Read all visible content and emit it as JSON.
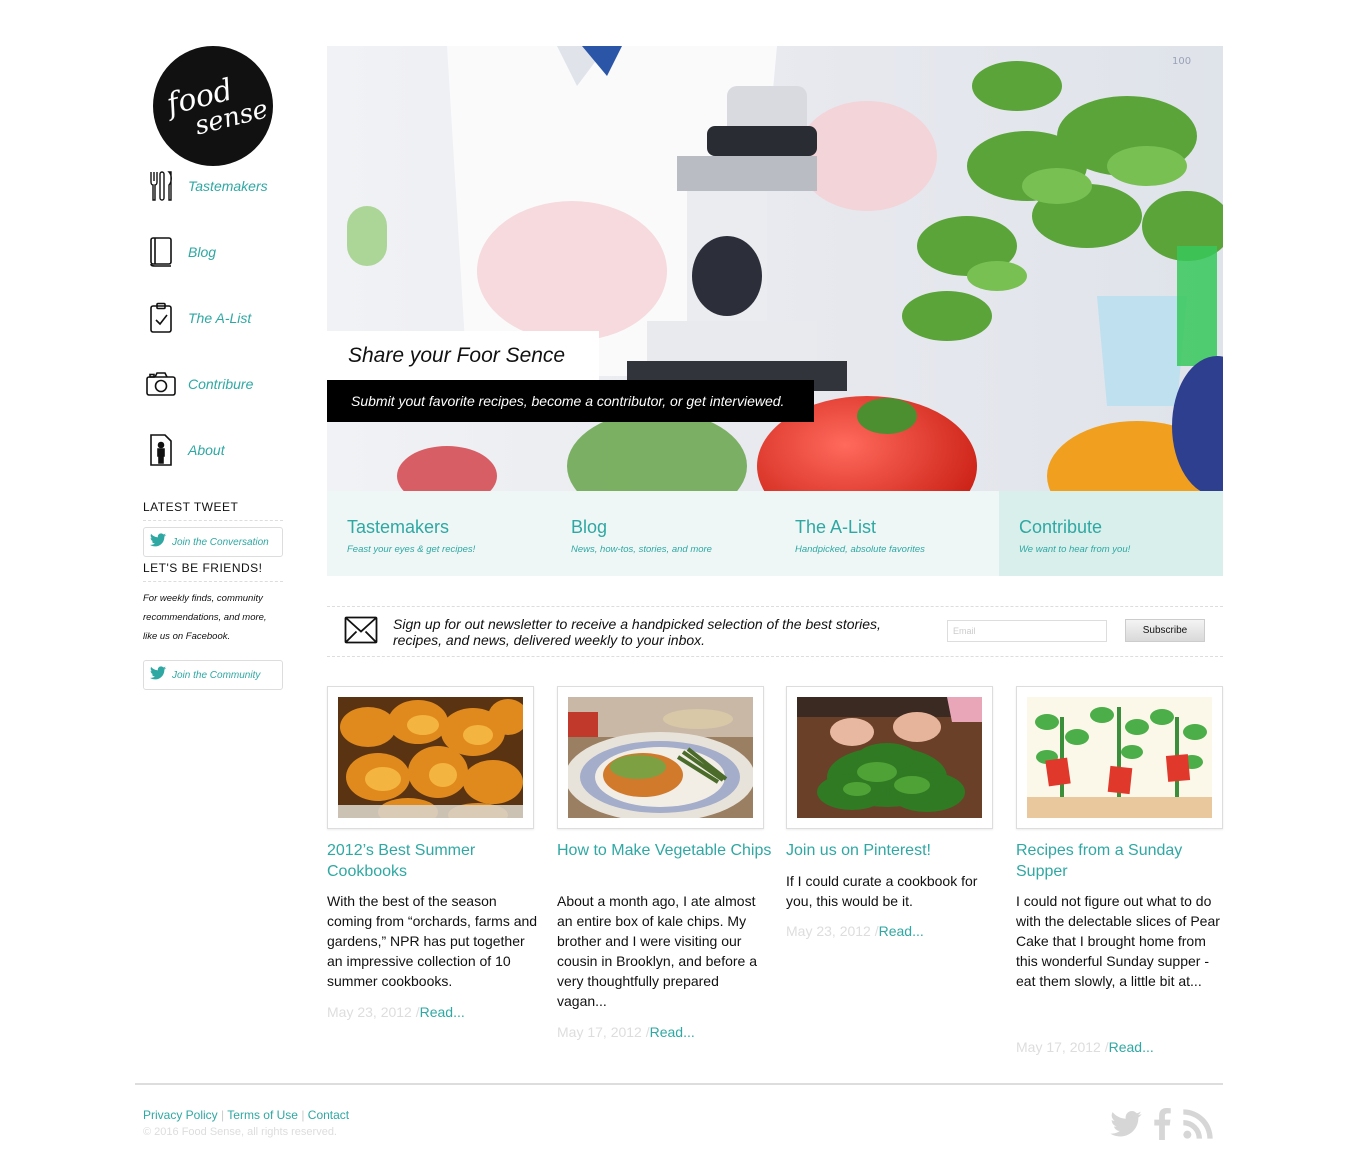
{
  "brand": {
    "logo_text_1": "food",
    "logo_text_2": "sense"
  },
  "sidebar": {
    "nav": [
      {
        "label": "Tastemakers",
        "icon": "cutlery-icon"
      },
      {
        "label": "Blog",
        "icon": "book-icon"
      },
      {
        "label": "The A-List",
        "icon": "clipboard-check-icon"
      },
      {
        "label": "Contribure",
        "icon": "camera-icon"
      },
      {
        "label": "About",
        "icon": "person-icon"
      }
    ],
    "latest_tweet_heading": "LATEST TWEET",
    "tweet_button": "Join the Conversation",
    "friends_heading": "LET'S BE FRIENDS!",
    "friends_text": "For weekly finds, community recommendations, and more, like us on Facebook.",
    "community_button": "Join the Community"
  },
  "hero": {
    "title": "Share your Foor Sence",
    "subtitle": "Submit yout favorite recipes, become a contributor, or get interviewed."
  },
  "tabs": [
    {
      "title": "Tastemakers",
      "sub": "Feast your eyes & get recipes!"
    },
    {
      "title": "Blog",
      "sub": "News, how-tos, stories, and more"
    },
    {
      "title": "The A-List",
      "sub": "Handpicked, absolute favorites"
    },
    {
      "title": "Contribute",
      "sub": "We want to hear from you!"
    }
  ],
  "newsletter": {
    "text": "Sign up for out newsletter to receive a handpicked selection of the best stories, recipes, and news, delivered weekly to your inbox.",
    "email_placeholder": "Email",
    "button": "Subscribe"
  },
  "posts": [
    {
      "title": "2012’s Best Summer Cookbooks",
      "body": "With the best of the season coming from “orchards, farms and gardens,” NPR has put together an impressive collection of 10 summer cookbooks.",
      "date": "May 23, 2012",
      "sep": "/",
      "read": "Read..."
    },
    {
      "title": "How to Make Vegetable Chips",
      "body": "About a month ago, I ate almost an entire box of kale chips. My brother and I were visiting our cousin in Brooklyn, and before a very thoughtfully prepared vagan...",
      "date": "May 17, 2012",
      "sep": "/",
      "read": "Read..."
    },
    {
      "title": "Join us on Pinterest!",
      "body": "If I could curate a cookbook for you, this would be it.",
      "date": "May 23, 2012",
      "sep": "/",
      "read": "Read..."
    },
    {
      "title": "Recipes from a Sunday Supper",
      "body": "I could not figure out what to do with the delectable slices of Pear Cake that I brought home from this wonderful Sunday supper - eat them slowly, a little bit at...",
      "date": "May 17, 2012",
      "sep": "/",
      "read": "Read..."
    }
  ],
  "footer": {
    "links": [
      "Privacy Policy",
      "Terms of Use",
      "Contact"
    ],
    "sep": "|",
    "copyright": "© 2016 Food Sense, all rights reserved.",
    "social": [
      "twitter-icon",
      "facebook-icon",
      "rss-icon"
    ]
  },
  "colors": {
    "accent": "#2fa8a3",
    "tab_bg": "#eef7f6",
    "tab_active_bg": "#d8efec"
  }
}
